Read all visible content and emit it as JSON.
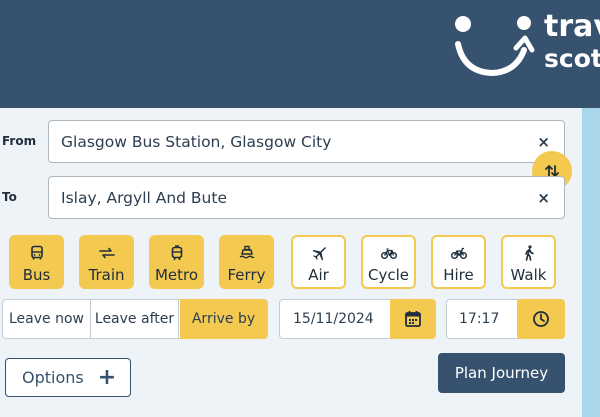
{
  "header": {
    "logo_line1": "trav",
    "logo_line2": "scot",
    "background": "#36526e"
  },
  "journey": {
    "from_label": "From",
    "from_value": "Glasgow Bus Station, Glasgow City",
    "to_label": "To",
    "to_value": "Islay, Argyll And Bute",
    "clear_glyph": "×"
  },
  "modes": [
    {
      "label": "Bus",
      "icon": "bus-icon",
      "selected": true
    },
    {
      "label": "Train",
      "icon": "train-icon",
      "selected": true
    },
    {
      "label": "Metro",
      "icon": "metro-icon",
      "selected": true
    },
    {
      "label": "Ferry",
      "icon": "ferry-icon",
      "selected": true
    },
    {
      "label": "Air",
      "icon": "plane-icon",
      "selected": false
    },
    {
      "label": "Cycle",
      "icon": "bicycle-icon",
      "selected": false
    },
    {
      "label": "Hire",
      "icon": "hire-bike-icon",
      "selected": false
    },
    {
      "label": "Walk",
      "icon": "walk-icon",
      "selected": false
    }
  ],
  "timing": {
    "options": [
      "Leave now",
      "Leave after",
      "Arrive by"
    ],
    "selected": "Arrive by",
    "date": "15/11/2024",
    "time": "17:17"
  },
  "actions": {
    "options_label": "Options",
    "plan_label": "Plan Journey"
  },
  "colors": {
    "accent": "#f3c94f",
    "navy": "#36526e",
    "panel": "#eef3f8",
    "strip": "#a9d6ea"
  }
}
